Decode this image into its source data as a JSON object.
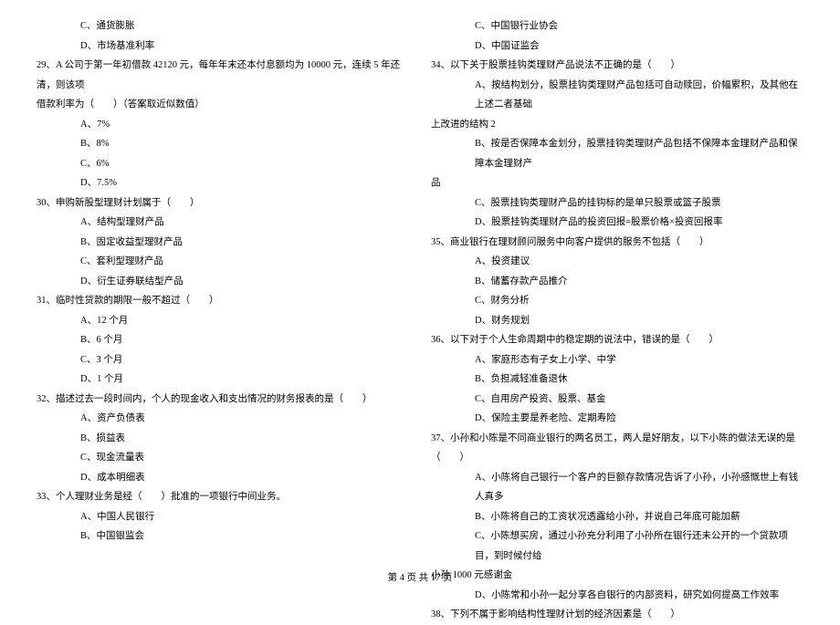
{
  "left": {
    "opt_c_28": "C、通货膨胀",
    "opt_d_28": "D、市场基准利率",
    "q29": "29、A 公司于第一年初借款 42120 元，每年年末还本付息额均为 10000 元，连续 5 年还清，则该项",
    "q29b": "借款利率为（　　）（答案取近似数值）",
    "q29_a": "A、7%",
    "q29_b": "B、8%",
    "q29_c": "C、6%",
    "q29_d": "D、7.5%",
    "q30": "30、申购新股型理财计划属于（　　）",
    "q30_a": "A、结构型理财产品",
    "q30_b": "B、固定收益型理财产品",
    "q30_c": "C、套利型理财产品",
    "q30_d": "D、衍生证券联结型产品",
    "q31": "31、临时性贷款的期限一般不超过（　　）",
    "q31_a": "A、12 个月",
    "q31_b": "B、6 个月",
    "q31_c": "C、3 个月",
    "q31_d": "D、1 个月",
    "q32": "32、描述过去一段时间内，个人的现金收入和支出情况的财务报表的是（　　）",
    "q32_a": "A、资产负债表",
    "q32_b": "B、损益表",
    "q32_c": "C、现金流量表",
    "q32_d": "D、成本明细表",
    "q33": "33、个人理财业务是经（　　）批准的一项银行中间业务。",
    "q33_a": "A、中国人民银行",
    "q33_b": "B、中国银监会"
  },
  "right": {
    "q33_c": "C、中国银行业协会",
    "q33_d": "D、中国证监会",
    "q34": "34、以下关于股票挂钩类理财产品说法不正确的是（　　）",
    "q34_a": "A、按结构划分，股票挂钩类理财产品包括可自动赎回，价幅累积，及其他在上述二者基础",
    "q34_a2": "上改进的结构 2",
    "q34_b": "B、按是否保障本金划分，股票挂钩类理财产品包括不保障本金理财产品和保障本金理财产",
    "q34_b2": "品",
    "q34_c": "C、股票挂钩类理财产品的挂钩标的是单只股票或篮子股票",
    "q34_d": "D、股票挂钩类理财产品的投资回报=股票价格×投资回报率",
    "q35": "35、商业银行在理财顾问服务中向客户提供的服务不包括（　　）",
    "q35_a": "A、投资建议",
    "q35_b": "B、储蓄存款产品推介",
    "q35_c": "C、财务分析",
    "q35_d": "D、财务规划",
    "q36": "36、以下对于个人生命周期中的稳定期的说法中，错误的是（　　）",
    "q36_a": "A、家庭形态有子女上小学、中学",
    "q36_b": "B、负担减轻准备退休",
    "q36_c": "C、自用房产投资、股票、基金",
    "q36_d": "D、保险主要是养老险、定期寿险",
    "q37": "37、小孙和小陈是不同商业银行的两名员工，两人是好朋友，以下小陈的做法无误的是（　　）",
    "q37_a": "A、小陈将自己银行一个客户的巨额存款情况告诉了小孙，小孙感慨世上有钱人真多",
    "q37_b": "B、小陈将自己的工资状况透露给小孙，并说自己年底可能加薪",
    "q37_c": "C、小陈想买房，通过小孙充分利用了小孙所在银行还未公开的一个贷款项目，到时候付给",
    "q37_c2": "小孙 1000 元感谢金",
    "q37_d": "D、小陈常和小孙一起分享各自银行的内部资料，研究如何提高工作效率",
    "q38": "38、下列不属于影响结构性理财计划的经济因素是（　　）"
  },
  "footer": "第 4 页 共 17 页"
}
